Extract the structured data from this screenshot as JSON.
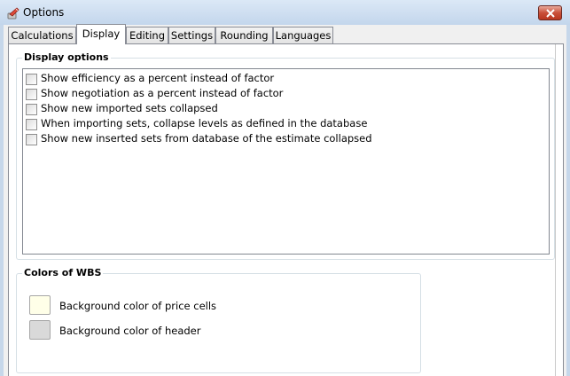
{
  "window": {
    "title": "Options",
    "app_icon": "options-icon",
    "close_icon": "close-icon"
  },
  "tabs": [
    {
      "label": "Calculations",
      "active": false
    },
    {
      "label": "Display",
      "active": true
    },
    {
      "label": "Editing",
      "active": false
    },
    {
      "label": "Settings",
      "active": false
    },
    {
      "label": "Rounding",
      "active": false
    },
    {
      "label": "Languages",
      "active": false
    }
  ],
  "display_options": {
    "title": "Display options",
    "items": [
      {
        "label": "Show efficiency as a percent instead of factor",
        "checked": false
      },
      {
        "label": "Show negotiation as a percent instead of factor",
        "checked": false
      },
      {
        "label": "Show new imported sets collapsed",
        "checked": false
      },
      {
        "label": "When importing sets, collapse levels as defined in the database",
        "checked": false
      },
      {
        "label": "Show new inserted sets from database of the estimate collapsed",
        "checked": false
      }
    ]
  },
  "colors_of_wbs": {
    "title": "Colors of WBS",
    "items": [
      {
        "label": "Background color of price cells",
        "color": "#ffffe8"
      },
      {
        "label": "Background color of header",
        "color": "#d9d9d9"
      }
    ]
  }
}
